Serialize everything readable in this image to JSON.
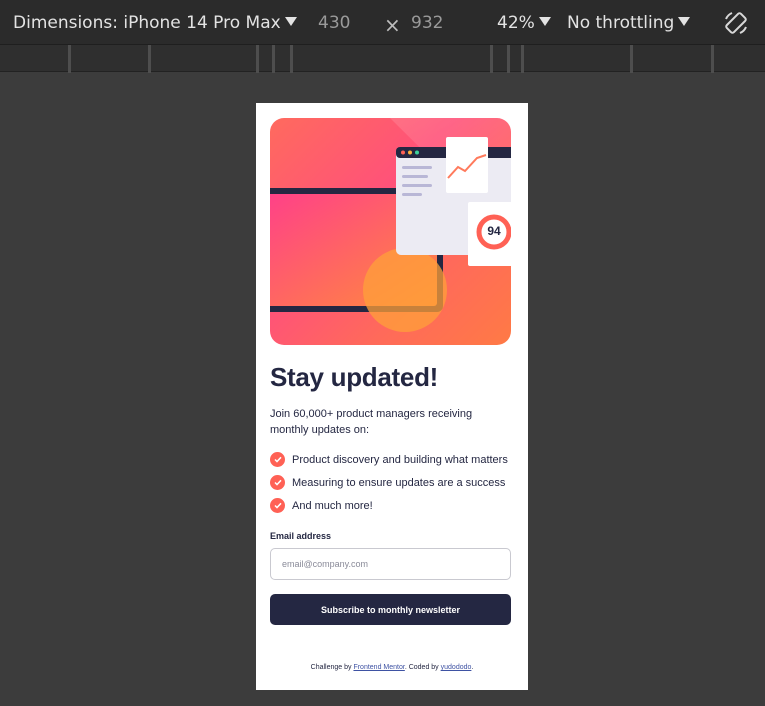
{
  "toolbar": {
    "dimensions_label": "Dimensions: iPhone 14 Pro Max",
    "width": "430",
    "times": "×",
    "height": "932",
    "zoom": "42%",
    "throttling": "No throttling",
    "rotate_icon": "rotate-device-icon"
  },
  "card": {
    "illustration": {
      "score": "94",
      "colors": {
        "gradient_start": "#ff5279",
        "gradient_end": "#ff7a45",
        "dark": "#242742"
      }
    },
    "title": "Stay updated!",
    "intro": "Join 60,000+ product managers receiving monthly updates on:",
    "list": [
      "Product discovery and building what matters",
      "Measuring to ensure updates are a success",
      "And much more!"
    ],
    "email_label": "Email address",
    "email_placeholder": "email@company.com",
    "email_value": "",
    "button_label": "Subscribe to monthly newsletter",
    "footer": {
      "prefix": "Challenge by ",
      "link1": "Frontend Mentor",
      "middle": ". Coded by ",
      "link2": "yudododo",
      "suffix": "."
    },
    "colors": {
      "accent": "#ff6155",
      "dark_navy": "#242742"
    }
  }
}
